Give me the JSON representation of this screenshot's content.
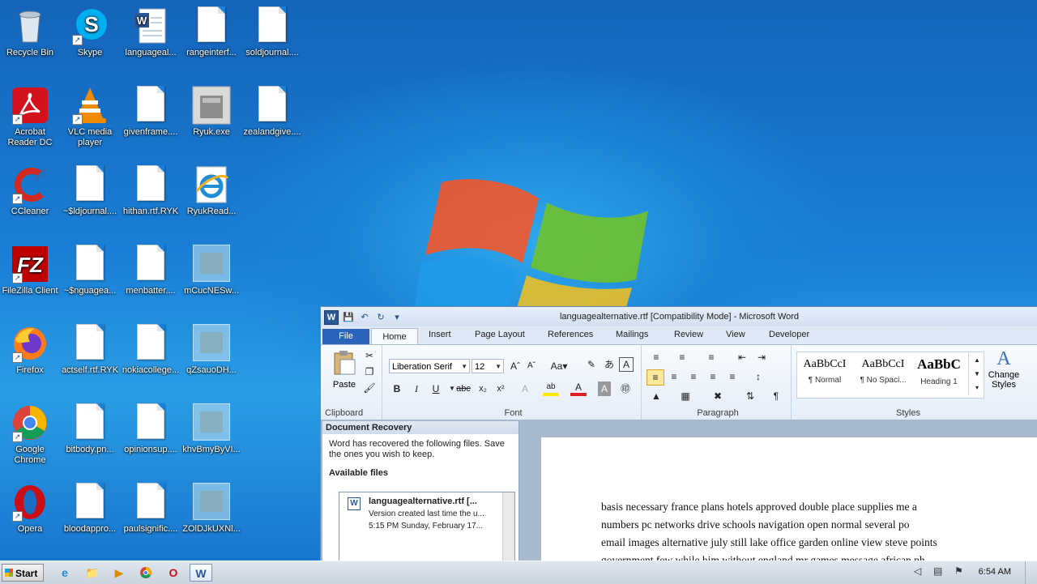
{
  "desktop": {
    "icons": [
      {
        "label": "Recycle Bin"
      },
      {
        "label": "Skype"
      },
      {
        "label": "languageal..."
      },
      {
        "label": "rangeinterf..."
      },
      {
        "label": "soldjournal...."
      },
      {
        "label": "Acrobat Reader DC"
      },
      {
        "label": "VLC media player"
      },
      {
        "label": "givenframe...."
      },
      {
        "label": "Ryuk.exe"
      },
      {
        "label": "zealandgive...."
      },
      {
        "label": "CCleaner"
      },
      {
        "label": "~$ldjournal...."
      },
      {
        "label": "hithan.rtf.RYK"
      },
      {
        "label": "RyukRead..."
      },
      {
        "label": "FileZilla Client"
      },
      {
        "label": "~$nguagea..."
      },
      {
        "label": "menbatter...."
      },
      {
        "label": "mCucNESw..."
      },
      {
        "label": "Firefox"
      },
      {
        "label": "actself.rtf.RYK"
      },
      {
        "label": "nokiacollege..."
      },
      {
        "label": "qZsauoDH..."
      },
      {
        "label": "Google Chrome"
      },
      {
        "label": "bitbody.pn..."
      },
      {
        "label": "opinionsup...."
      },
      {
        "label": "khvBmyByVI..."
      },
      {
        "label": "Opera"
      },
      {
        "label": "bloodappro..."
      },
      {
        "label": "paulsignific...."
      },
      {
        "label": "ZOlDJkUXNl..."
      }
    ]
  },
  "word": {
    "title": "languagealternative.rtf [Compatibility Mode]  -  Microsoft Word",
    "tabs": [
      "File",
      "Home",
      "Insert",
      "Page Layout",
      "References",
      "Mailings",
      "Review",
      "View",
      "Developer"
    ],
    "ribbon": {
      "paste": "Paste",
      "font_name": "Liberation Serif",
      "font_size": "12",
      "groups": [
        "Clipboard",
        "Font",
        "Paragraph",
        "Styles"
      ],
      "styles": [
        {
          "sample": "AaBbCcI",
          "name": "¶ Normal"
        },
        {
          "sample": "AaBbCcI",
          "name": "¶ No Spaci..."
        },
        {
          "sample": "AaBbC",
          "name": "Heading 1"
        }
      ],
      "change_styles": "Change Styles"
    },
    "recovery": {
      "header": "Document Recovery",
      "message": "Word has recovered the following files.  Save the ones you wish to keep.",
      "available": "Available files",
      "file": {
        "name": "languagealternative.rtf  [...",
        "desc": "Version created last time the u...",
        "time": "5:15 PM Sunday, February 17..."
      }
    },
    "document_lines": [
      "basis necessary    france   plans   hotels approved double place supplies   me    a",
      "numbers  pc networks    drive      schools navigation    open    normal     several po",
      "email  images  alternative       july still  lake office  garden online  view  steve points",
      "government  few while  him     without     england     mr   games message african  ph"
    ]
  },
  "taskbar": {
    "start": "Start",
    "clock": "6:54 AM"
  }
}
